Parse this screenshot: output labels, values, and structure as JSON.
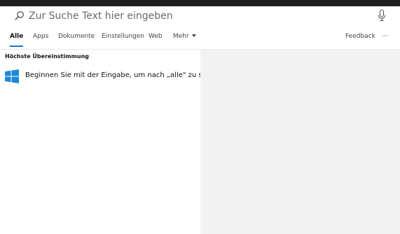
{
  "search": {
    "placeholder": "Zur Suche Text hier eingeben"
  },
  "tabs": {
    "items": [
      "Alle",
      "Apps",
      "Dokumente",
      "Einstellungen",
      "Web",
      "Mehr"
    ],
    "active": "Alle",
    "feedback": "Feedback",
    "more_options": "···"
  },
  "results": {
    "section_heading": "Höchste Übereinstimmung",
    "best_match_text": "Beginnen Sie mit der Eingabe, um nach „alle\" zu suchen"
  },
  "colors": {
    "accent": "#1a73c8",
    "windows_logo": "#1e88d4",
    "preview_background": "#f2f2f2",
    "top_border": "#1f1f1f"
  },
  "icons": {
    "search": "search-icon",
    "microphone": "microphone-icon",
    "windows": "windows-logo-icon",
    "dropdown": "caret-down-icon"
  }
}
